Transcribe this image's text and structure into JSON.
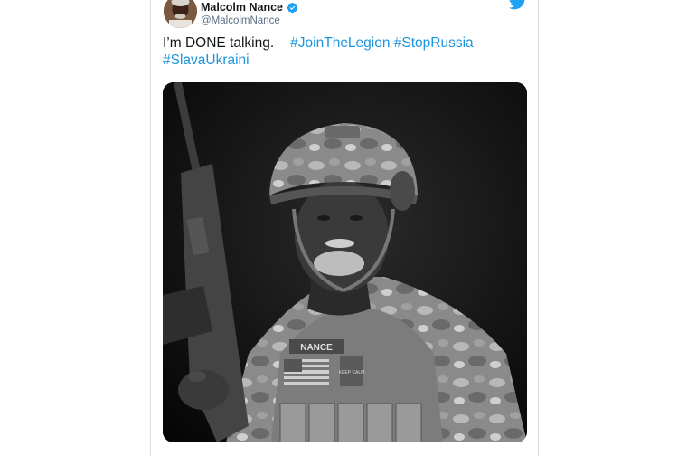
{
  "author": {
    "name": "Malcolm Nance",
    "handle": "@MalcolmNance",
    "verified": true
  },
  "tweet": {
    "text": "I’m DONE talking.",
    "hashtags": [
      "#JoinTheLegion",
      "#StopRussia",
      "#SlavaUkraini"
    ]
  },
  "media": {
    "description_tags": [
      "nametape-text"
    ],
    "nametape": "NANCE",
    "patch_text": "KEEP CALM"
  },
  "colors": {
    "hashtag": "#1b95e0",
    "twitter_brand": "#1da1f2",
    "verified": "#1da1f2"
  },
  "icons": {
    "brand": "twitter-bird-icon",
    "verified": "verified-badge-icon"
  }
}
